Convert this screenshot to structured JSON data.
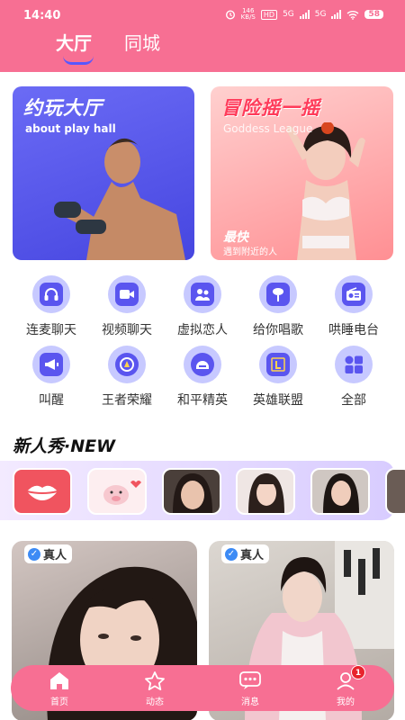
{
  "status_bar": {
    "time": "14:40",
    "net_speed": "146",
    "net_unit": "KB/S",
    "hd": "HD",
    "sig1": "5G",
    "sig2": "5G",
    "battery": "58"
  },
  "header": {
    "tabs": [
      {
        "label": "大厅",
        "active": true
      },
      {
        "label": "同城",
        "active": false
      }
    ]
  },
  "banners": {
    "left": {
      "title": "约玩大厅",
      "subtitle": "about play hall"
    },
    "right": {
      "title": "冒险摇一摇",
      "subtitle": "Goddess League",
      "tag": "最快",
      "tag_sub": "遇到附近的人"
    }
  },
  "categories": [
    {
      "label": "连麦聊天",
      "icon": "headset-icon"
    },
    {
      "label": "视频聊天",
      "icon": "video-camera-icon"
    },
    {
      "label": "虚拟恋人",
      "icon": "couple-icon"
    },
    {
      "label": "给你唱歌",
      "icon": "microphone-icon"
    },
    {
      "label": "哄睡电台",
      "icon": "radio-icon"
    },
    {
      "label": "叫醒",
      "icon": "megaphone-icon"
    },
    {
      "label": "王者荣耀",
      "icon": "king-glory-icon"
    },
    {
      "label": "和平精英",
      "icon": "helmet-icon"
    },
    {
      "label": "英雄联盟",
      "icon": "league-icon"
    },
    {
      "label": "全部",
      "icon": "grid-icon"
    }
  ],
  "new_section": {
    "title": "新人秀·NEW",
    "avatars": [
      "lips-avatar",
      "pig-avatar",
      "girl-avatar",
      "girl-avatar",
      "girl-avatar"
    ]
  },
  "cards": [
    {
      "badge": "真人"
    },
    {
      "badge": "真人"
    }
  ],
  "bottom_nav": {
    "items": [
      {
        "label": "首页",
        "icon": "home-icon"
      },
      {
        "label": "动态",
        "icon": "star-icon"
      },
      {
        "label": "消息",
        "icon": "chat-icon"
      },
      {
        "label": "我的",
        "icon": "profile-icon"
      }
    ],
    "badge_count": "1"
  },
  "colors": {
    "brand_pink": "#f76f93",
    "icon_purple": "#5a55ef",
    "icon_bg": "#c7c9ff",
    "badge_red": "#e8232d",
    "verified_blue": "#3d8bf5"
  }
}
